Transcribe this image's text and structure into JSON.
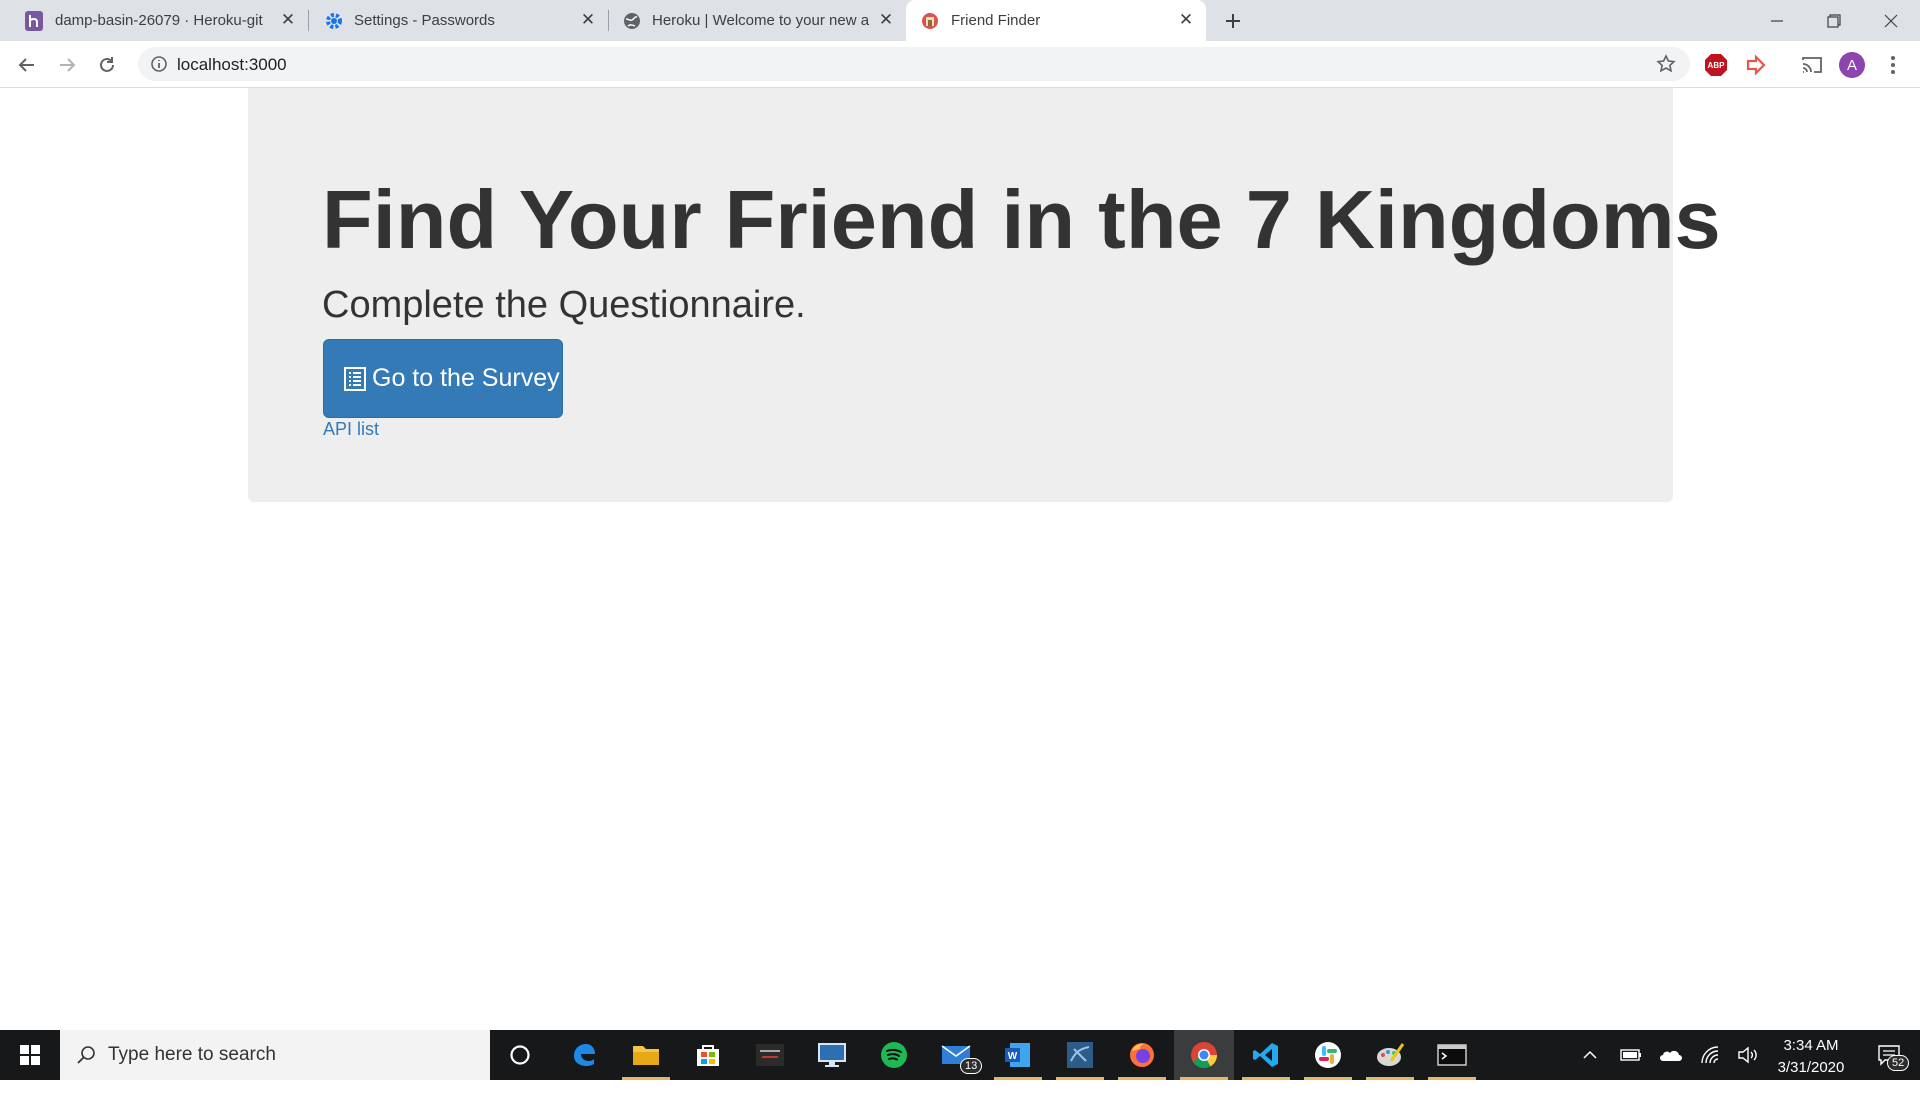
{
  "browser": {
    "tabs": [
      {
        "title": "damp-basin-26079 · Heroku-git |",
        "icon": "heroku-icon",
        "active": false
      },
      {
        "title": "Settings - Passwords",
        "icon": "gear-icon",
        "active": false
      },
      {
        "title": "Heroku | Welcome to your new a",
        "icon": "globe-icon",
        "active": false
      },
      {
        "title": "Friend Finder",
        "icon": "friend-finder-favicon",
        "active": true
      }
    ],
    "url": "localhost:3000",
    "profile_initial": "A",
    "ext_adblock_label": "ABP"
  },
  "page": {
    "headline": "Find Your Friend in the 7 Kingdoms",
    "lead": "Complete the Questionnaire.",
    "survey_button": "Go to the Survey",
    "api_link": "API list"
  },
  "taskbar": {
    "search_placeholder": "Type here to search",
    "time": "3:34 AM",
    "date": "3/31/2020",
    "mail_badge": "13",
    "notifications_badge": "52",
    "apps": [
      "cortana-icon",
      "edge-icon",
      "file-explorer-icon",
      "store-icon",
      "lenovo-app-icon",
      "remote-desktop-icon",
      "spotify-icon",
      "mail-icon",
      "word-icon",
      "mysql-workbench-icon",
      "firefox-icon",
      "chrome-icon",
      "vscode-icon",
      "slack-icon",
      "paint-icon",
      "terminal-icon"
    ]
  },
  "colors": {
    "accent": "#337ab7",
    "jumbotron_bg": "#eeeeee",
    "taskbar_bg": "#161819"
  }
}
